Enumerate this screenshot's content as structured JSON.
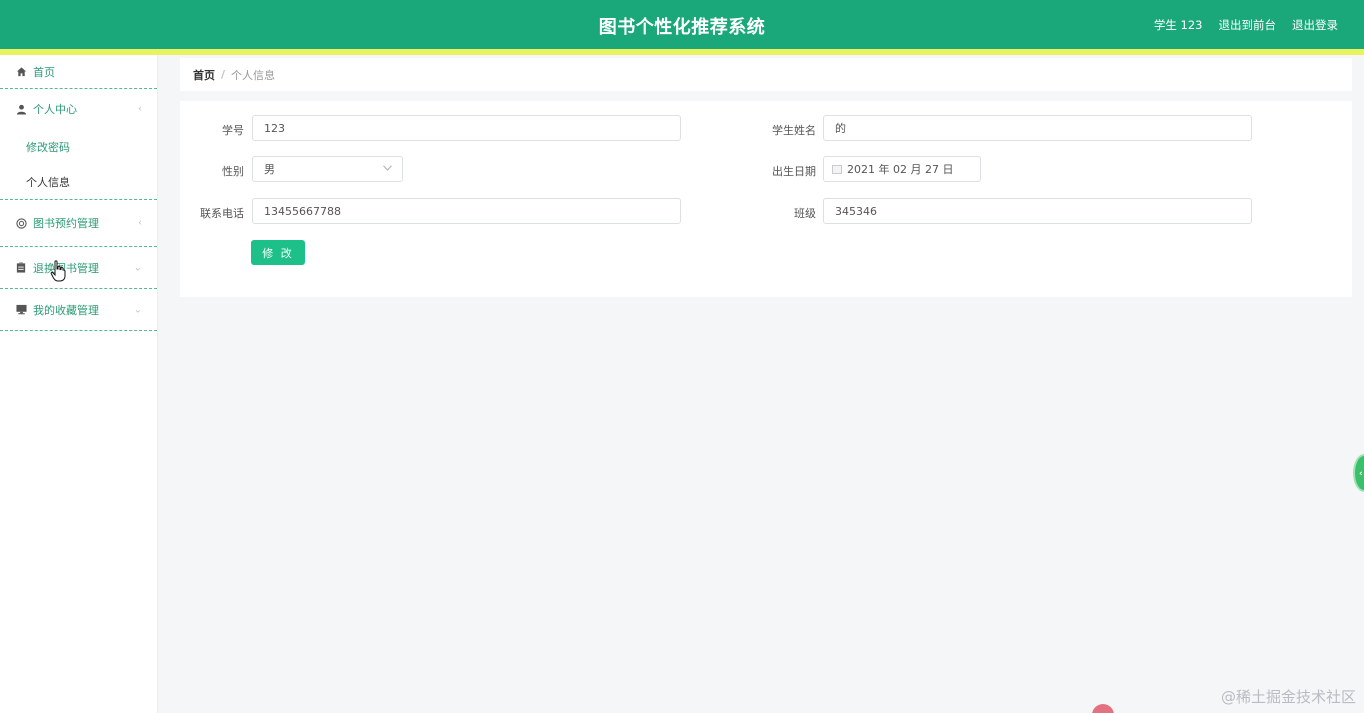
{
  "header": {
    "title": "图书个性化推荐系统",
    "user_label": "学生 123",
    "front_link": "退出到前台",
    "logout_link": "退出登录"
  },
  "sidebar": {
    "home": "首页",
    "personal_center": "个人中心",
    "change_password": "修改密码",
    "personal_info": "个人信息",
    "reservation_mgmt": "图书预约管理",
    "return_mgmt": "退换图书管理",
    "favorites_mgmt": "我的收藏管理"
  },
  "breadcrumb": {
    "home": "首页",
    "separator": "/",
    "current": "个人信息"
  },
  "form": {
    "student_id_label": "学号",
    "student_id_value": "123",
    "name_label": "学生姓名",
    "name_value": "的",
    "gender_label": "性别",
    "gender_value": "男",
    "birth_label": "出生日期",
    "birth_value": "2021 年 02 月 27 日",
    "phone_label": "联系电话",
    "phone_value": "13455667788",
    "class_label": "班级",
    "class_value": "345346",
    "submit_label": "修 改"
  },
  "watermark": "@稀土掘金技术社区",
  "colors": {
    "header_bg": "#1aa87a",
    "accent_bar": "#e9f25f",
    "menu_text": "#2c9b72",
    "button_bg": "#1ec08a"
  }
}
